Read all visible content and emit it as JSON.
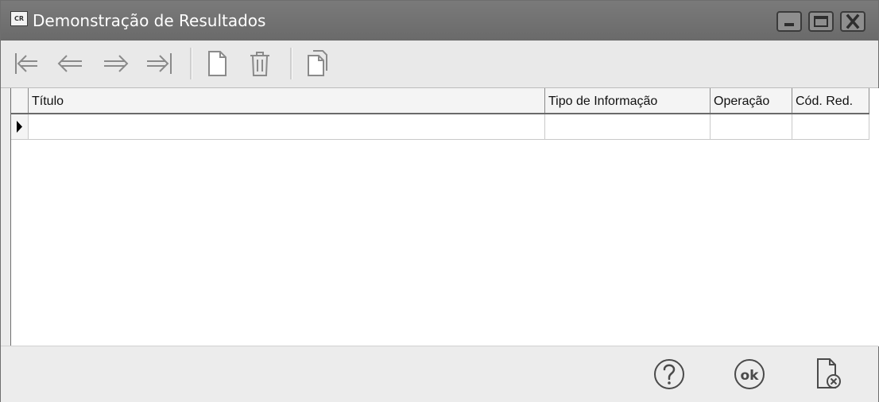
{
  "window": {
    "app_icon_text": "CR",
    "title": "Demonstração de Resultados"
  },
  "toolbar": {
    "buttons": [
      {
        "name": "first-record",
        "icon": "arrow-first-icon"
      },
      {
        "name": "previous-record",
        "icon": "arrow-left-icon"
      },
      {
        "name": "next-record",
        "icon": "arrow-right-icon"
      },
      {
        "name": "last-record",
        "icon": "arrow-last-icon"
      },
      {
        "name": "new-record",
        "icon": "new-document-icon"
      },
      {
        "name": "delete-record",
        "icon": "trash-icon"
      },
      {
        "name": "copy-record",
        "icon": "copy-document-icon"
      }
    ]
  },
  "grid": {
    "columns": [
      "Título",
      "Tipo de Informação",
      "Operação",
      "Cód. Red."
    ],
    "rows": [
      [
        "",
        "",
        "",
        ""
      ]
    ]
  },
  "footer": {
    "buttons": [
      {
        "name": "help",
        "icon": "question-icon"
      },
      {
        "name": "ok",
        "icon": "ok-icon",
        "label": "ok"
      },
      {
        "name": "cancel",
        "icon": "cancel-document-icon"
      }
    ]
  },
  "colors": {
    "titlebar": "#6e6e6e",
    "title_text": "#ffffff",
    "icon_gray": "#8a8a8a",
    "icon_dark": "#4a4a4a"
  }
}
